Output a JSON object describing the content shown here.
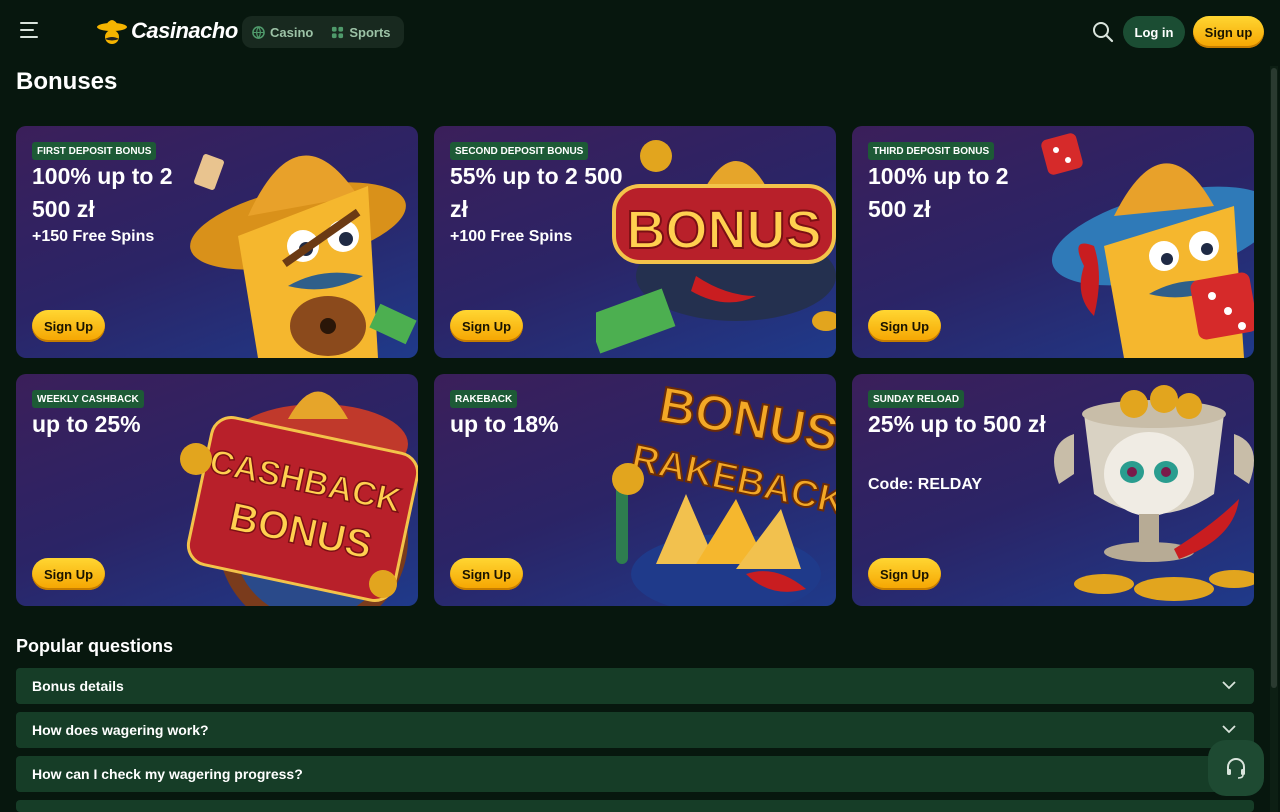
{
  "header": {
    "brand": "Casinacho",
    "nav": [
      {
        "label": "Casino",
        "icon": "globe-icon"
      },
      {
        "label": "Sports",
        "icon": "dice-icon"
      }
    ],
    "login_label": "Log in",
    "signup_label": "Sign up"
  },
  "page_title": "Bonuses",
  "cards": [
    {
      "badge": "FIRST DEPOSIT BONUS",
      "title": "100% up to 2 500 zł",
      "sub": "+150 Free Spins",
      "button": "Sign Up"
    },
    {
      "badge": "SECOND DEPOSIT BONUS",
      "title": "55% up to 2 500 zł",
      "sub": "+100 Free Spins",
      "button": "Sign Up",
      "art_text": "BONUS"
    },
    {
      "badge": "THIRD DEPOSIT BONUS",
      "title": "100% up to 2 500 zł",
      "sub": "",
      "button": "Sign Up"
    },
    {
      "badge": "WEEKLY CASHBACK",
      "title": "up to 25%",
      "sub": "",
      "button": "Sign Up",
      "art_text_1": "CASHBACK",
      "art_text_2": "BONUS"
    },
    {
      "badge": "RAKEBACK",
      "title": "up to 18%",
      "sub": "",
      "button": "Sign Up",
      "art_text_1": "BONUS",
      "art_text_2": "RAKEBACK"
    },
    {
      "badge": "SUNDAY RELOAD",
      "title": "25% up to 500 zł",
      "sub": "Code: RELDAY",
      "button": "Sign Up"
    }
  ],
  "faq": {
    "title": "Popular questions",
    "items": [
      "Bonus details",
      "How does wagering work?",
      "How can I check my wagering progress?"
    ]
  },
  "colors": {
    "background": "#07170e",
    "accent_yellow": "#f5b400",
    "faq_bg": "#163d27",
    "badge_green": "#1d5a36"
  }
}
